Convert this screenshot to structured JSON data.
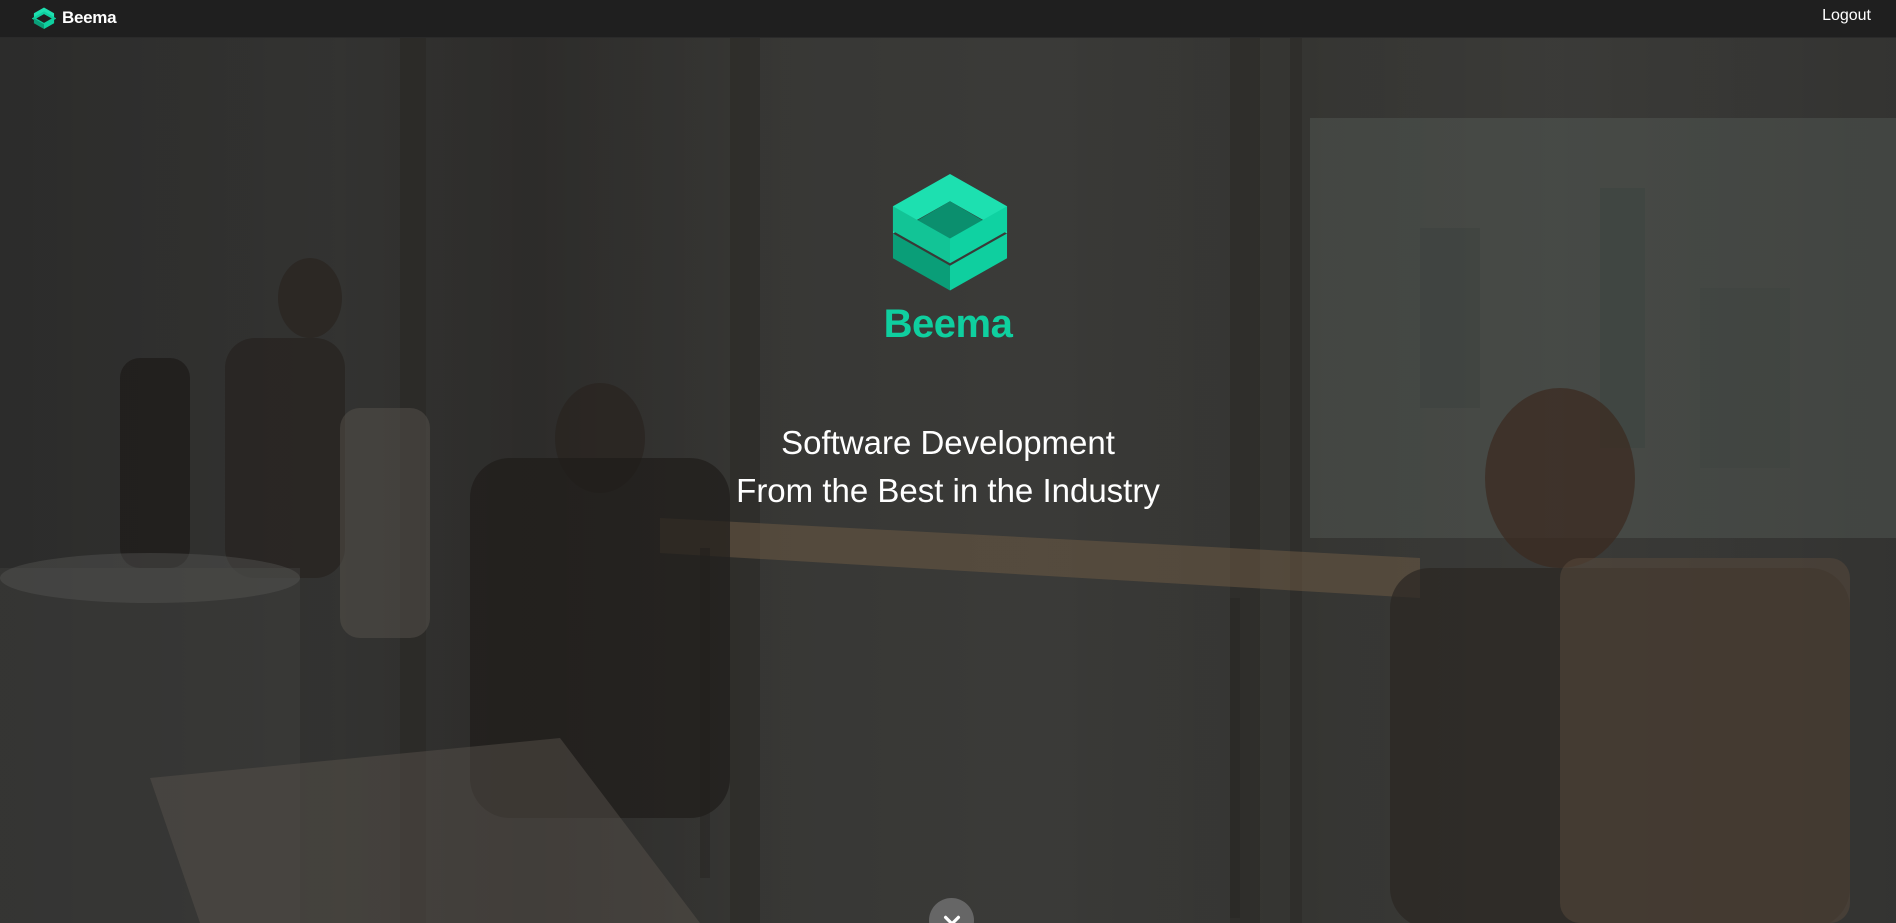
{
  "navbar": {
    "brand_name": "Beema",
    "brand_icon": "beema-logo-icon",
    "logout_label": "Logout",
    "background": "#1f1f1f"
  },
  "hero": {
    "logo_icon": "beema-logo-icon",
    "brand_name": "Beema",
    "tagline_line1": "Software Development",
    "tagline_line2": "From the Best in the Industry",
    "scroll_icon": "chevron-down-icon",
    "background_image": "office-team-working-overlooking-city-photo"
  },
  "colors": {
    "accent": "#0fcf9f",
    "accent_light": "#1de0b0",
    "accent_dark": "#0a9e78",
    "overlay": "#202020"
  }
}
